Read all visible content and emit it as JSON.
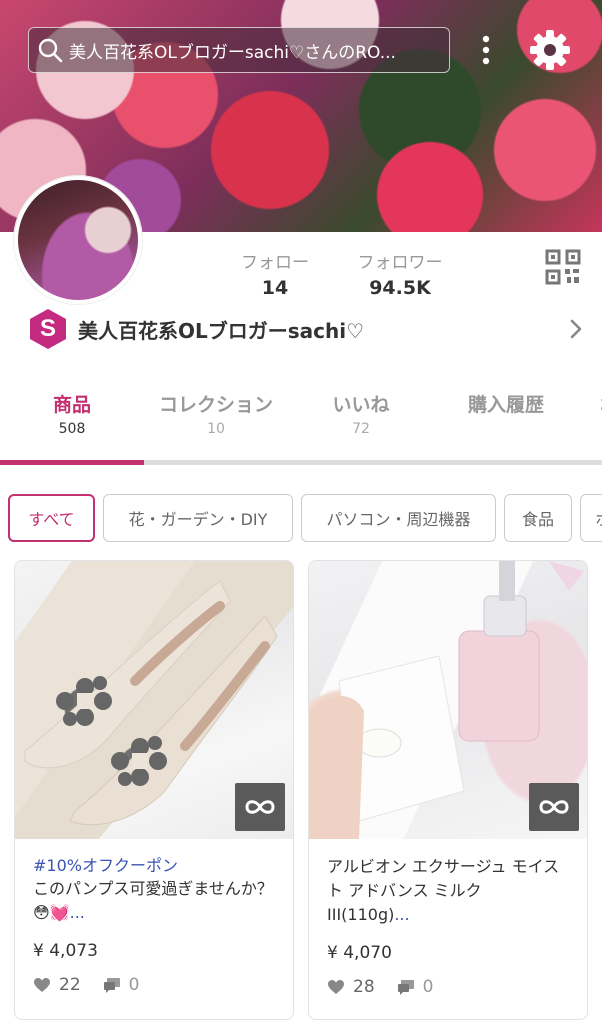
{
  "header": {
    "search_text": "美人百花系OLブロガーsachi♡さんのRO..."
  },
  "profile": {
    "stats": [
      {
        "label": "フォロー",
        "value": "14"
      },
      {
        "label": "フォロワー",
        "value": "94.5K"
      }
    ],
    "badge_letter": "S",
    "name": "美人百花系OLブロガーsachi♡"
  },
  "tabs": [
    {
      "label": "商品",
      "count": "508",
      "active": true
    },
    {
      "label": "コレクション",
      "count": "10"
    },
    {
      "label": "いいね",
      "count": "72"
    },
    {
      "label": "購入履歴",
      "count": ""
    },
    {
      "label": "お",
      "count": ""
    }
  ],
  "chips": [
    "すべて",
    "花・ガーデン・DIY",
    "パソコン・周辺機器",
    "食品",
    "ホ"
  ],
  "products": [
    {
      "hashtag": "#10%オフクーポン",
      "desc": "このパンプス可愛過ぎませんか？😳💓",
      "more": "...",
      "price": "¥ 4,073",
      "likes": "22",
      "comments": "0"
    },
    {
      "hashtag": "",
      "desc": "アルビオン エクサージュ モイスト アドバンス ミルク III(110g)",
      "more": "...",
      "price": "¥ 4,070",
      "likes": "28",
      "comments": "0"
    }
  ],
  "colors": {
    "accent": "#c3306f",
    "link": "#3a55b3",
    "badge": "#c42a7f"
  }
}
